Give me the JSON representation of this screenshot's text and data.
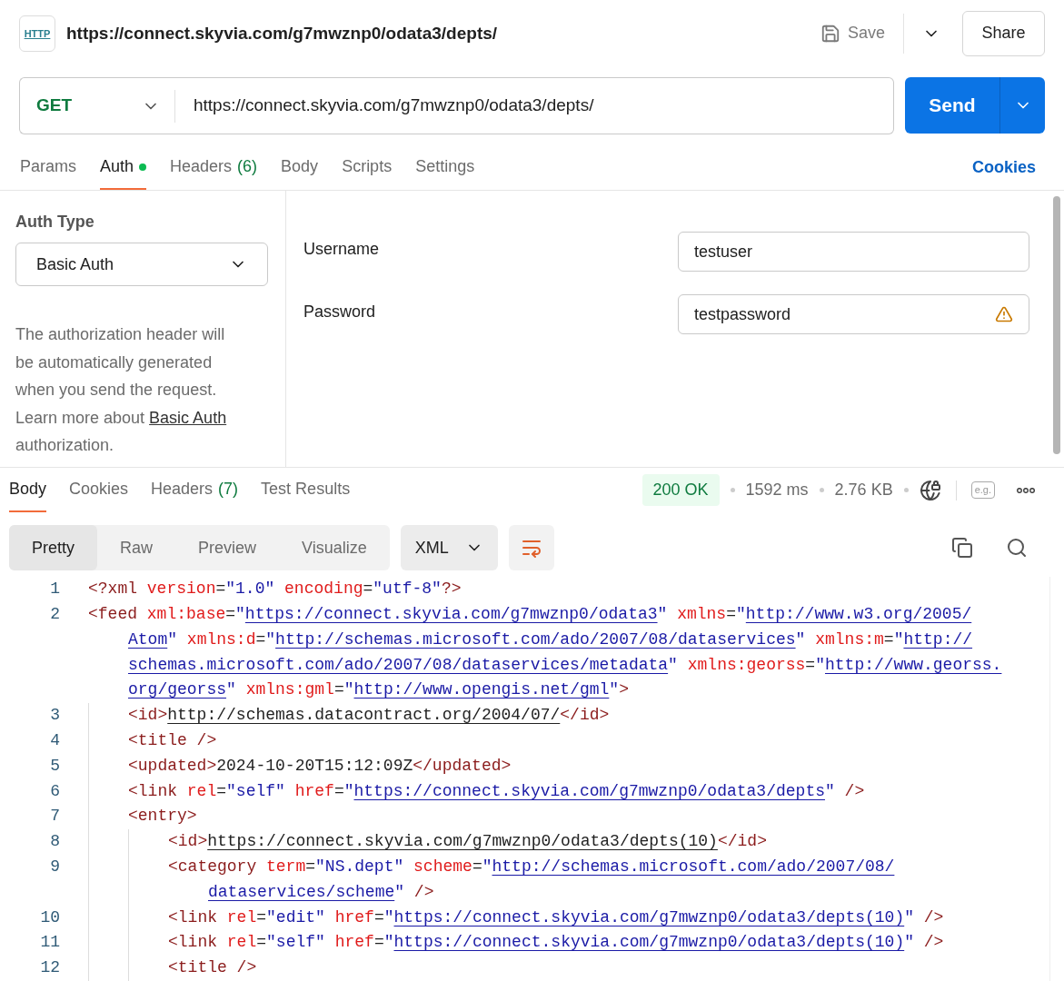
{
  "header": {
    "logo_text": "HTTP",
    "title": "https://connect.skyvia.com/g7mwznp0/odata3/depts/",
    "save_label": "Save",
    "share_label": "Share"
  },
  "request": {
    "method": "GET",
    "url": "https://connect.skyvia.com/g7mwznp0/odata3/depts/",
    "send_label": "Send"
  },
  "request_tabs": [
    {
      "label": "Params",
      "selected": false
    },
    {
      "label": "Auth",
      "dot": true,
      "selected": true
    },
    {
      "label": "Headers",
      "count": "(6)",
      "selected": false
    },
    {
      "label": "Body",
      "selected": false
    },
    {
      "label": "Scripts",
      "selected": false
    },
    {
      "label": "Settings",
      "selected": false
    }
  ],
  "cookies_link": "Cookies",
  "auth": {
    "type_label": "Auth Type",
    "type_value": "Basic Auth",
    "help_before": "The authorization header will be automatically generated when you send the request. Learn more about ",
    "help_link": "Basic Auth",
    "help_after": " authorization.",
    "fields": [
      {
        "label": "Username",
        "value": "testuser",
        "warning": false
      },
      {
        "label": "Password",
        "value": "testpassword",
        "warning": true
      }
    ]
  },
  "response_tabs": [
    {
      "label": "Body",
      "selected": true
    },
    {
      "label": "Cookies",
      "selected": false
    },
    {
      "label": "Headers",
      "count": "(7)",
      "selected": false
    },
    {
      "label": "Test Results",
      "selected": false
    }
  ],
  "status": {
    "code": "200 OK",
    "time": "1592 ms",
    "size": "2.76 KB",
    "example_label": "e.g."
  },
  "view_tabs": [
    {
      "label": "Pretty",
      "selected": true
    },
    {
      "label": "Raw",
      "selected": false
    },
    {
      "label": "Preview",
      "selected": false
    },
    {
      "label": "Visualize",
      "selected": false
    }
  ],
  "format": "XML",
  "code": [
    {
      "number": "1",
      "rows": [
        {
          "tokens": [
            {
              "kind": "tag",
              "text": "<?xml"
            },
            {
              "kind": "attr",
              "text": " version"
            },
            {
              "kind": "op",
              "text": "="
            },
            {
              "kind": "str",
              "text": "\"1.0\""
            },
            {
              "kind": "attr",
              "text": " encoding"
            },
            {
              "kind": "op",
              "text": "="
            },
            {
              "kind": "str",
              "text": "\"utf-8\""
            },
            {
              "kind": "tag",
              "text": "?>"
            }
          ]
        }
      ]
    },
    {
      "number": "2",
      "rows": [
        {
          "tokens": [
            {
              "kind": "tag",
              "text": "<feed"
            },
            {
              "kind": "attr",
              "text": " xml:base"
            },
            {
              "kind": "op",
              "text": "="
            },
            {
              "kind": "str",
              "text": "\""
            },
            {
              "kind": "link",
              "text": "https://connect.skyvia.com/g7mwznp0/odata3"
            },
            {
              "kind": "str",
              "text": "\""
            },
            {
              "kind": "attr",
              "text": " xmlns"
            },
            {
              "kind": "op",
              "text": "="
            },
            {
              "kind": "str",
              "text": "\""
            },
            {
              "kind": "link",
              "text": "http://www.w3.org/2005/"
            }
          ]
        },
        {
          "tokens": [
            {
              "kind": "link",
              "text": "Atom"
            },
            {
              "kind": "str",
              "text": "\""
            },
            {
              "kind": "attr",
              "text": " xmlns:d"
            },
            {
              "kind": "op",
              "text": "="
            },
            {
              "kind": "str",
              "text": "\""
            },
            {
              "kind": "link",
              "text": "http://schemas.microsoft.com/ado/2007/08/dataservices"
            },
            {
              "kind": "str",
              "text": "\""
            },
            {
              "kind": "attr",
              "text": " xmlns:m"
            },
            {
              "kind": "op",
              "text": "="
            },
            {
              "kind": "str",
              "text": "\""
            },
            {
              "kind": "link",
              "text": "http://"
            }
          ]
        },
        {
          "tokens": [
            {
              "kind": "link",
              "text": "schemas.microsoft.com/ado/2007/08/dataservices/metadata"
            },
            {
              "kind": "str",
              "text": "\""
            },
            {
              "kind": "attr",
              "text": " xmlns:georss"
            },
            {
              "kind": "op",
              "text": "="
            },
            {
              "kind": "str",
              "text": "\""
            },
            {
              "kind": "link",
              "text": "http://www.georss."
            }
          ]
        },
        {
          "tokens": [
            {
              "kind": "link",
              "text": "org/georss"
            },
            {
              "kind": "str",
              "text": "\""
            },
            {
              "kind": "attr",
              "text": " xmlns:gml"
            },
            {
              "kind": "op",
              "text": "="
            },
            {
              "kind": "str",
              "text": "\""
            },
            {
              "kind": "link",
              "text": "http://www.opengis.net/gml"
            },
            {
              "kind": "str",
              "text": "\""
            },
            {
              "kind": "tag",
              "text": ">"
            }
          ]
        }
      ],
      "children": [
        {
          "number": "3",
          "rows": [
            {
              "tokens": [
                {
                  "kind": "tag",
                  "text": "<id>"
                },
                {
                  "kind": "textlink",
                  "text": "http://schemas.datacontract.org/2004/07/"
                },
                {
                  "kind": "tag",
                  "text": "</id>"
                }
              ]
            }
          ]
        },
        {
          "number": "4",
          "rows": [
            {
              "tokens": [
                {
                  "kind": "tag",
                  "text": "<title />"
                }
              ]
            }
          ]
        },
        {
          "number": "5",
          "rows": [
            {
              "tokens": [
                {
                  "kind": "tag",
                  "text": "<updated>"
                },
                {
                  "kind": "text",
                  "text": "2024-10-20T15:12:09Z"
                },
                {
                  "kind": "tag",
                  "text": "</updated>"
                }
              ]
            }
          ]
        },
        {
          "number": "6",
          "rows": [
            {
              "tokens": [
                {
                  "kind": "tag",
                  "text": "<link"
                },
                {
                  "kind": "attr",
                  "text": " rel"
                },
                {
                  "kind": "op",
                  "text": "="
                },
                {
                  "kind": "str",
                  "text": "\"self\""
                },
                {
                  "kind": "attr",
                  "text": " href"
                },
                {
                  "kind": "op",
                  "text": "="
                },
                {
                  "kind": "str",
                  "text": "\""
                },
                {
                  "kind": "link",
                  "text": "https://connect.skyvia.com/g7mwznp0/odata3/depts"
                },
                {
                  "kind": "str",
                  "text": "\""
                },
                {
                  "kind": "tag",
                  "text": " />"
                }
              ]
            }
          ]
        },
        {
          "number": "7",
          "rows": [
            {
              "tokens": [
                {
                  "kind": "tag",
                  "text": "<entry>"
                }
              ]
            }
          ],
          "children": [
            {
              "number": "8",
              "rows": [
                {
                  "tokens": [
                    {
                      "kind": "tag",
                      "text": "<id>"
                    },
                    {
                      "kind": "textlink",
                      "text": "https://connect.skyvia.com/g7mwznp0/odata3/depts(10)"
                    },
                    {
                      "kind": "tag",
                      "text": "</id>"
                    }
                  ]
                }
              ]
            },
            {
              "number": "9",
              "rows": [
                {
                  "tokens": [
                    {
                      "kind": "tag",
                      "text": "<category"
                    },
                    {
                      "kind": "attr",
                      "text": " term"
                    },
                    {
                      "kind": "op",
                      "text": "="
                    },
                    {
                      "kind": "str",
                      "text": "\"NS.dept\""
                    },
                    {
                      "kind": "attr",
                      "text": " scheme"
                    },
                    {
                      "kind": "op",
                      "text": "="
                    },
                    {
                      "kind": "str",
                      "text": "\""
                    },
                    {
                      "kind": "link",
                      "text": "http://schemas.microsoft.com/ado/2007/08/"
                    }
                  ]
                },
                {
                  "tokens": [
                    {
                      "kind": "link",
                      "text": "dataservices/scheme"
                    },
                    {
                      "kind": "str",
                      "text": "\""
                    },
                    {
                      "kind": "tag",
                      "text": " />"
                    }
                  ]
                }
              ]
            },
            {
              "number": "10",
              "rows": [
                {
                  "tokens": [
                    {
                      "kind": "tag",
                      "text": "<link"
                    },
                    {
                      "kind": "attr",
                      "text": " rel"
                    },
                    {
                      "kind": "op",
                      "text": "="
                    },
                    {
                      "kind": "str",
                      "text": "\"edit\""
                    },
                    {
                      "kind": "attr",
                      "text": " href"
                    },
                    {
                      "kind": "op",
                      "text": "="
                    },
                    {
                      "kind": "str",
                      "text": "\""
                    },
                    {
                      "kind": "link",
                      "text": "https://connect.skyvia.com/g7mwznp0/odata3/depts(10)"
                    },
                    {
                      "kind": "str",
                      "text": "\""
                    },
                    {
                      "kind": "tag",
                      "text": " />"
                    }
                  ]
                }
              ]
            },
            {
              "number": "11",
              "rows": [
                {
                  "tokens": [
                    {
                      "kind": "tag",
                      "text": "<link"
                    },
                    {
                      "kind": "attr",
                      "text": " rel"
                    },
                    {
                      "kind": "op",
                      "text": "="
                    },
                    {
                      "kind": "str",
                      "text": "\"self\""
                    },
                    {
                      "kind": "attr",
                      "text": " href"
                    },
                    {
                      "kind": "op",
                      "text": "="
                    },
                    {
                      "kind": "str",
                      "text": "\""
                    },
                    {
                      "kind": "link",
                      "text": "https://connect.skyvia.com/g7mwznp0/odata3/depts(10)"
                    },
                    {
                      "kind": "str",
                      "text": "\""
                    },
                    {
                      "kind": "tag",
                      "text": " />"
                    }
                  ]
                }
              ]
            },
            {
              "number": "12",
              "rows": [
                {
                  "tokens": [
                    {
                      "kind": "tag",
                      "text": "<title />"
                    }
                  ]
                }
              ]
            }
          ]
        }
      ]
    }
  ]
}
